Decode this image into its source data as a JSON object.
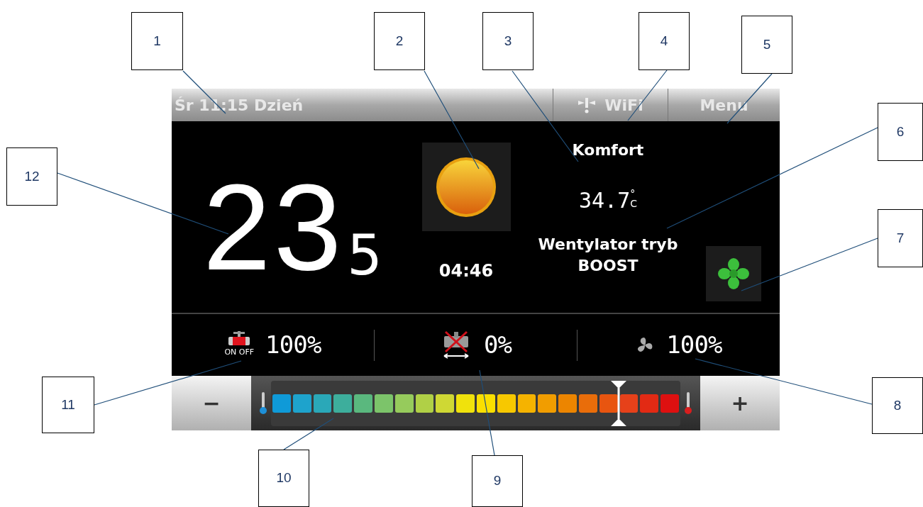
{
  "status_bar": {
    "day_time": "Śr 11:15 Dzień",
    "wifi": "WiFi",
    "menu": "Menu"
  },
  "temperature": {
    "whole": "23",
    "fraction": "5"
  },
  "mode": "Komfort",
  "outdoor": {
    "value": "34.7",
    "degree": "°",
    "unit": "C"
  },
  "timer": "04:46",
  "fan_mode_lines": [
    "Wentylator tryb",
    "BOOST"
  ],
  "indicators": [
    {
      "kind": "valve",
      "label": "ON OFF",
      "value": "100%"
    },
    {
      "kind": "damper",
      "value": "0%"
    },
    {
      "kind": "fan",
      "value": "100%"
    }
  ],
  "slider": {
    "minus": "−",
    "plus": "+",
    "level": 0.85,
    "segments": [
      {
        "color": "#0f9ad8"
      },
      {
        "color": "#1ea3cc"
      },
      {
        "color": "#2aa8b8"
      },
      {
        "color": "#3dae9c"
      },
      {
        "color": "#5ab87e"
      },
      {
        "color": "#7cc46a"
      },
      {
        "color": "#96cb5c"
      },
      {
        "color": "#b0d046"
      },
      {
        "color": "#cfd834"
      },
      {
        "color": "#f0e20c"
      },
      {
        "color": "#fadf00"
      },
      {
        "color": "#f7c800"
      },
      {
        "color": "#f5b300"
      },
      {
        "color": "#f19d00"
      },
      {
        "color": "#ec8500"
      },
      {
        "color": "#e96d0a"
      },
      {
        "color": "#e85510"
      },
      {
        "color": "#e6411a"
      },
      {
        "color": "#e22a14"
      },
      {
        "color": "#de1010"
      }
    ]
  },
  "callouts": [
    "1",
    "2",
    "3",
    "4",
    "5",
    "6",
    "7",
    "8",
    "9",
    "10",
    "11",
    "12"
  ]
}
